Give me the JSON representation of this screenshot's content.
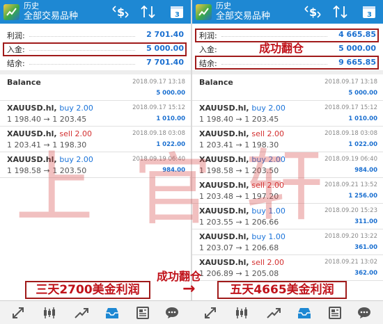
{
  "appbar": {
    "title": "历史",
    "subtitle": "全部交易品种",
    "calendar_day": "3",
    "icons": [
      "app-logo-icon",
      "dollar-swap-icon",
      "sort-icon",
      "calendar-icon"
    ]
  },
  "left": {
    "summary": {
      "profit_label": "利润:",
      "profit": "2 701.40",
      "deposit_label": "入金:",
      "deposit": "5 000.00",
      "balance_label": "结余:",
      "balance": "7 701.40"
    },
    "balance_row": {
      "label": "Balance",
      "time": "2018.09.17 13:18",
      "amount": "5 000.00"
    },
    "deals": [
      {
        "symbol": "XAUUSD.hl,",
        "side": "buy",
        "lots": "2.00",
        "open": "1 198.40",
        "close": "1 203.45",
        "time": "2018.09.17 15:12",
        "profit": "1 010.00"
      },
      {
        "symbol": "XAUUSD.hl,",
        "side": "sell",
        "lots": "2.00",
        "open": "1 203.41",
        "close": "1 198.30",
        "time": "2018.09.18 03:08",
        "profit": "1 022.00"
      },
      {
        "symbol": "XAUUSD.hl,",
        "side": "buy",
        "lots": "2.00",
        "open": "1 198.58",
        "close": "1 203.50",
        "time": "2018.09.19 06:40",
        "profit": "984.00"
      }
    ]
  },
  "right": {
    "summary": {
      "profit_label": "利润:",
      "profit": "4 665.85",
      "deposit_label": "入金:",
      "deposit": "5 000.00",
      "balance_label": "结余:",
      "balance": "9 665.85"
    },
    "balance_row": {
      "label": "Balance",
      "time": "2018.09.17 13:18",
      "amount": "5 000.00"
    },
    "deals": [
      {
        "symbol": "XAUUSD.hl,",
        "side": "buy",
        "lots": "2.00",
        "open": "1 198.40",
        "close": "1 203.45",
        "time": "2018.09.17 15:12",
        "profit": "1 010.00"
      },
      {
        "symbol": "XAUUSD.hl,",
        "side": "sell",
        "lots": "2.00",
        "open": "1 203.41",
        "close": "1 198.30",
        "time": "2018.09.18 03:08",
        "profit": "1 022.00"
      },
      {
        "symbol": "XAUUSD.hl,",
        "side": "buy",
        "lots": "2.00",
        "open": "1 198.58",
        "close": "1 203.50",
        "time": "2018.09.19 06:40",
        "profit": "984.00"
      },
      {
        "symbol": "XAUUSD.hl,",
        "side": "sell",
        "lots": "2.00",
        "open": "1 203.48",
        "close": "1 197.20",
        "time": "2018.09.21 13:52",
        "profit": "1 256.00"
      },
      {
        "symbol": "XAUUSD.hl,",
        "side": "buy",
        "lots": "1.00",
        "open": "1 203.55",
        "close": "1 206.66",
        "time": "2018.09.20 15:23",
        "profit": "311.00"
      },
      {
        "symbol": "XAUUSD.hl,",
        "side": "buy",
        "lots": "1.00",
        "open": "1 203.07",
        "close": "1 206.68",
        "time": "2018.09.20 13:22",
        "profit": "361.00"
      },
      {
        "symbol": "XAUUSD.hl,",
        "side": "sell",
        "lots": "2.00",
        "open": "1 206.89",
        "close": "1 205.08",
        "time": "2018.09.21 13:02",
        "profit": "362.00"
      }
    ]
  },
  "annotations": {
    "success_top": "成功翻仓",
    "success_bottom": "成功翻仓",
    "left_callout": "三天2700美金利润",
    "right_callout": "五天4665美金利润",
    "arrow": "→"
  },
  "watermark": [
    "上",
    "官",
    "轩"
  ],
  "colors": {
    "appbar": "#1e88d3",
    "buy": "#1a73d9",
    "sell": "#d32f2f",
    "highlight_box": "#a01a1a",
    "annotation": "#c0121a"
  },
  "bottom_nav": [
    "quotes-icon",
    "chart-icon",
    "trade-icon",
    "history-icon",
    "news-icon",
    "chat-icon"
  ]
}
